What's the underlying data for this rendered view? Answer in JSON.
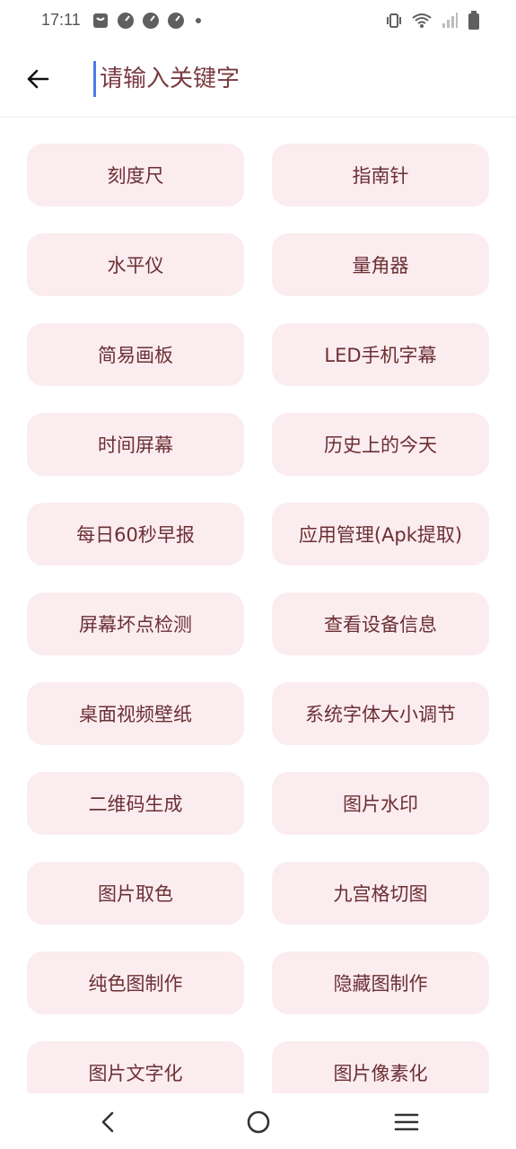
{
  "status_bar": {
    "time": "17:11",
    "left_icons": [
      "bag-icon",
      "gauge-icon",
      "gauge-icon",
      "gauge-icon",
      "dot-icon"
    ],
    "right_icons": [
      "vibrate-icon",
      "wifi-icon",
      "signal-icon",
      "battery-icon"
    ]
  },
  "search": {
    "placeholder": "请输入关键字",
    "value": ""
  },
  "tools": [
    {
      "label": "刻度尺"
    },
    {
      "label": "指南针"
    },
    {
      "label": "水平仪"
    },
    {
      "label": "量角器"
    },
    {
      "label": "简易画板"
    },
    {
      "label": "LED手机字幕"
    },
    {
      "label": "时间屏幕"
    },
    {
      "label": "历史上的今天"
    },
    {
      "label": "每日60秒早报"
    },
    {
      "label": "应用管理(Apk提取)"
    },
    {
      "label": "屏幕坏点检测"
    },
    {
      "label": "查看设备信息"
    },
    {
      "label": "桌面视频壁纸"
    },
    {
      "label": "系统字体大小调节"
    },
    {
      "label": "二维码生成"
    },
    {
      "label": "图片水印"
    },
    {
      "label": "图片取色"
    },
    {
      "label": "九宫格切图"
    },
    {
      "label": "纯色图制作"
    },
    {
      "label": "隐藏图制作"
    },
    {
      "label": "图片文字化"
    },
    {
      "label": "图片像素化"
    }
  ],
  "colors": {
    "button_bg": "#fbecef",
    "button_text": "#6b2f34",
    "cursor": "#4a7be0"
  }
}
